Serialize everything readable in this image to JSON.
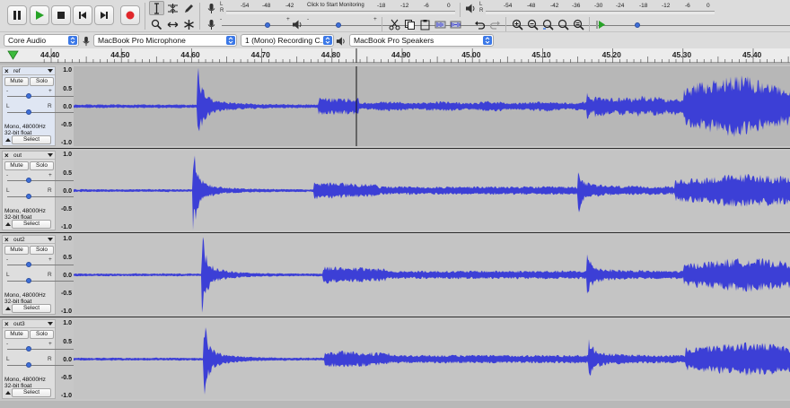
{
  "toolbar": {
    "transport": [
      {
        "name": "pause-button",
        "icon": "pause-icon"
      },
      {
        "name": "play-button",
        "icon": "play-icon"
      },
      {
        "name": "stop-button",
        "icon": "stop-icon"
      },
      {
        "name": "skip-to-start-button",
        "icon": "skip-start-icon"
      },
      {
        "name": "skip-to-end-button",
        "icon": "skip-end-icon"
      },
      {
        "name": "record-button",
        "icon": "record-icon"
      }
    ],
    "record_meter": {
      "channels": [
        "L",
        "R"
      ],
      "scale": [
        "-54",
        "-48",
        "-42",
        "",
        "-18",
        "-12",
        "-6",
        "0"
      ],
      "prompt": "Click to Start Monitoring"
    },
    "play_meter": {
      "channels": [
        "L",
        "R"
      ],
      "scale": [
        "-54",
        "-48",
        "-42",
        "-36",
        "-30",
        "-24",
        "-18",
        "-12",
        "-6",
        "0"
      ]
    },
    "mixer": {
      "rec_minus": "-",
      "rec_plus": "+",
      "play_minus": "-",
      "play_plus": "+",
      "rec_volume": 0.72,
      "play_volume": 0.45
    },
    "play_at_speed": {
      "speed": 0.52
    },
    "colors": {
      "record": "#e0262a",
      "play": "#27a327",
      "accent": "#3b78e7"
    }
  },
  "devices": {
    "host": "Core Audio",
    "input": "MacBook Pro Microphone",
    "channels": "1 (Mono) Recording C...",
    "output": "MacBook Pro Speakers"
  },
  "ruler": {
    "labels": [
      "44.40",
      "44.50",
      "44.60",
      "44.70",
      "44.80",
      "44.90",
      "45.00",
      "45.10",
      "45.20",
      "45.30",
      "45.40"
    ]
  },
  "common": {
    "mute": "Mute",
    "solo": "Solo",
    "select": "Select",
    "close": "×",
    "gain_minus": "-",
    "gain_plus": "+",
    "pan_left": "L",
    "pan_right": "R",
    "scale": [
      "1.0",
      "0.5",
      "0.0",
      "-0.5",
      "-1.0"
    ]
  },
  "tracks": [
    {
      "name": "ref",
      "rate": "Mono, 48000Hz",
      "format": "32-bit float",
      "selected": true
    },
    {
      "name": "out",
      "rate": "Mono, 48000Hz",
      "format": "32-bit float",
      "selected": false
    },
    {
      "name": "out2",
      "rate": "Mono, 48000Hz",
      "format": "32-bit float",
      "selected": false
    },
    {
      "name": "out3",
      "rate": "Mono, 48000Hz",
      "format": "32-bit float",
      "selected": false
    }
  ],
  "waveform_color": "#3c3fd6"
}
